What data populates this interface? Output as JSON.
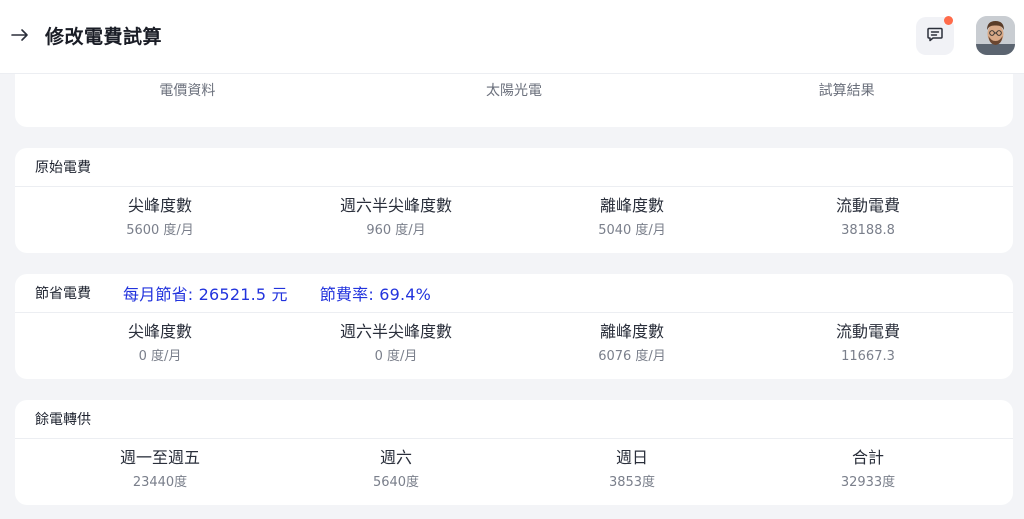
{
  "header": {
    "title": "修改電費試算",
    "back_icon": "arrow-right-icon"
  },
  "tabs": [
    {
      "label": "電價資料"
    },
    {
      "label": "太陽光電"
    },
    {
      "label": "試算結果"
    }
  ],
  "original": {
    "title": "原始電費",
    "stats": [
      {
        "label": "尖峰度數",
        "value": "5600 度/月"
      },
      {
        "label": "週六半尖峰度數",
        "value": "960 度/月"
      },
      {
        "label": "離峰度數",
        "value": "5040 度/月"
      },
      {
        "label": "流動電費",
        "value": "38188.8"
      }
    ]
  },
  "savings": {
    "title": "節省電費",
    "monthly_saving": "每月節省: 26521.5 元",
    "saving_rate": "節費率: 69.4%",
    "stats": [
      {
        "label": "尖峰度數",
        "value": "0 度/月"
      },
      {
        "label": "週六半尖峰度數",
        "value": "0 度/月"
      },
      {
        "label": "離峰度數",
        "value": "6076 度/月"
      },
      {
        "label": "流動電費",
        "value": "11667.3"
      }
    ]
  },
  "surplus": {
    "title": "餘電轉供",
    "stats": [
      {
        "label": "週一至週五",
        "value": "23440度"
      },
      {
        "label": "週六",
        "value": "5640度"
      },
      {
        "label": "週日",
        "value": "3853度"
      },
      {
        "label": "合計",
        "value": "32933度"
      }
    ]
  },
  "colors": {
    "accent_blue": "#2233dd",
    "notification_dot": "#ff6b4a"
  }
}
